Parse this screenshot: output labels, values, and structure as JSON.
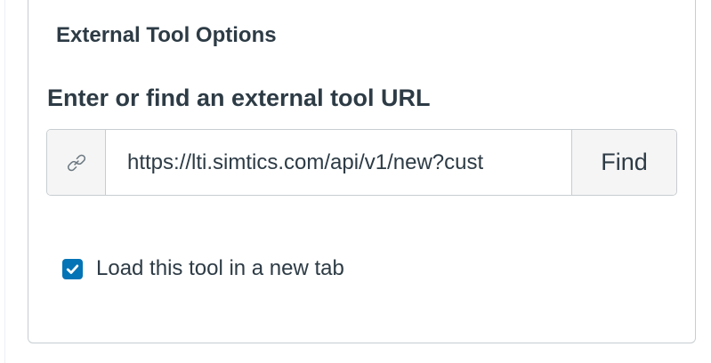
{
  "panel": {
    "title": "External Tool Options"
  },
  "url_field": {
    "label": "Enter or find an external tool URL",
    "value": "https://lti.simtics.com/api/v1/new?cust",
    "prefix_icon": "link-icon",
    "find_label": "Find"
  },
  "new_tab_option": {
    "label": "Load this tool in a new tab",
    "checked": true
  },
  "colors": {
    "accent": "#0374b5",
    "text": "#2d3b45",
    "border": "#c7cdd1",
    "addon_background": "#f5f5f5"
  }
}
